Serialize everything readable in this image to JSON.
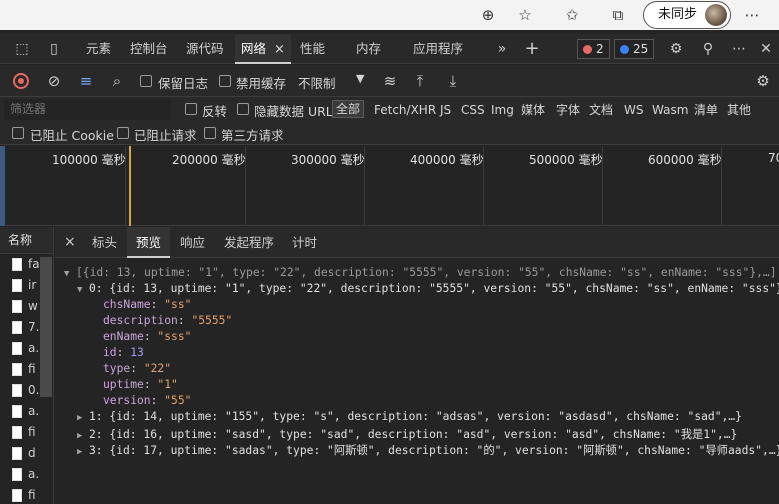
{
  "browser": {
    "sync_label": "未同步",
    "icons": [
      "zoom-icon",
      "favorite-add-icon",
      "favorites-icon",
      "collections-icon",
      "more-icon"
    ]
  },
  "devtools": {
    "tabs": [
      {
        "label": "元素"
      },
      {
        "label": "控制台"
      },
      {
        "label": "源代码"
      },
      {
        "label": "网络"
      },
      {
        "label": "性能"
      },
      {
        "label": "内存"
      },
      {
        "label": "应用程序"
      }
    ],
    "active_tab_close": "×",
    "errors_count": "2",
    "issues_count": "25"
  },
  "toolbar": {
    "preserve_log": "保留日志",
    "disable_cache": "禁用缓存",
    "throttle": "不限制"
  },
  "filter": {
    "placeholder": "筛选器",
    "invert": "反转",
    "hide_data_urls": "隐藏数据 URL",
    "types": [
      "全部",
      "Fetch/XHR",
      "JS",
      "CSS",
      "Img",
      "媒体",
      "字体",
      "文档",
      "WS",
      "Wasm",
      "清单",
      "其他"
    ],
    "blocked_cookies": "已阻止 Cookie",
    "blocked_requests": "已阻止请求",
    "third_party": "第三方请求"
  },
  "timeline": {
    "labels": [
      "100000 毫秒",
      "200000 毫秒",
      "300000 毫秒",
      "400000 毫秒",
      "500000 毫秒",
      "600000 毫秒",
      "70"
    ]
  },
  "requests": {
    "header": "名称",
    "items": [
      "fa",
      "ir",
      "w",
      "7.",
      "a.",
      "fi",
      "0.",
      "a.",
      "fi",
      "d",
      "a.",
      "fi"
    ]
  },
  "details": {
    "close": "×",
    "tabs": [
      "标头",
      "预览",
      "响应",
      "发起程序",
      "计时"
    ],
    "active": "预览"
  },
  "preview": {
    "root_summary": "[{id: 13, uptime: \"1\", type: \"22\", description: \"5555\", version: \"55\", chsName: \"ss\", enName: \"sss\"},…]",
    "item0_summary": "0: {id: 13, uptime: \"1\", type: \"22\", description: \"5555\", version: \"55\", chsName: \"ss\", enName: \"sss\"}",
    "item0_props": [
      {
        "key": "chsName",
        "value": "\"ss\"",
        "kind": "str"
      },
      {
        "key": "description",
        "value": "\"5555\"",
        "kind": "str"
      },
      {
        "key": "enName",
        "value": "\"sss\"",
        "kind": "str"
      },
      {
        "key": "id",
        "value": "13",
        "kind": "num"
      },
      {
        "key": "type",
        "value": "\"22\"",
        "kind": "str"
      },
      {
        "key": "uptime",
        "value": "\"1\"",
        "kind": "str"
      },
      {
        "key": "version",
        "value": "\"55\"",
        "kind": "str"
      }
    ],
    "collapsed": [
      "1: {id: 14, uptime: \"155\", type: \"s\", description: \"adsas\", version: \"asdasd\", chsName: \"sad\",…}",
      "2: {id: 16, uptime: \"sasd\", type: \"sad\", description: \"asd\", version: \"asd\", chsName: \"我是1\",…}",
      "3: {id: 17, uptime: \"sadas\", type: \"阿斯顿\", description: \"的\", version: \"阿斯顿\", chsName: \"导师aads\",…}"
    ]
  }
}
